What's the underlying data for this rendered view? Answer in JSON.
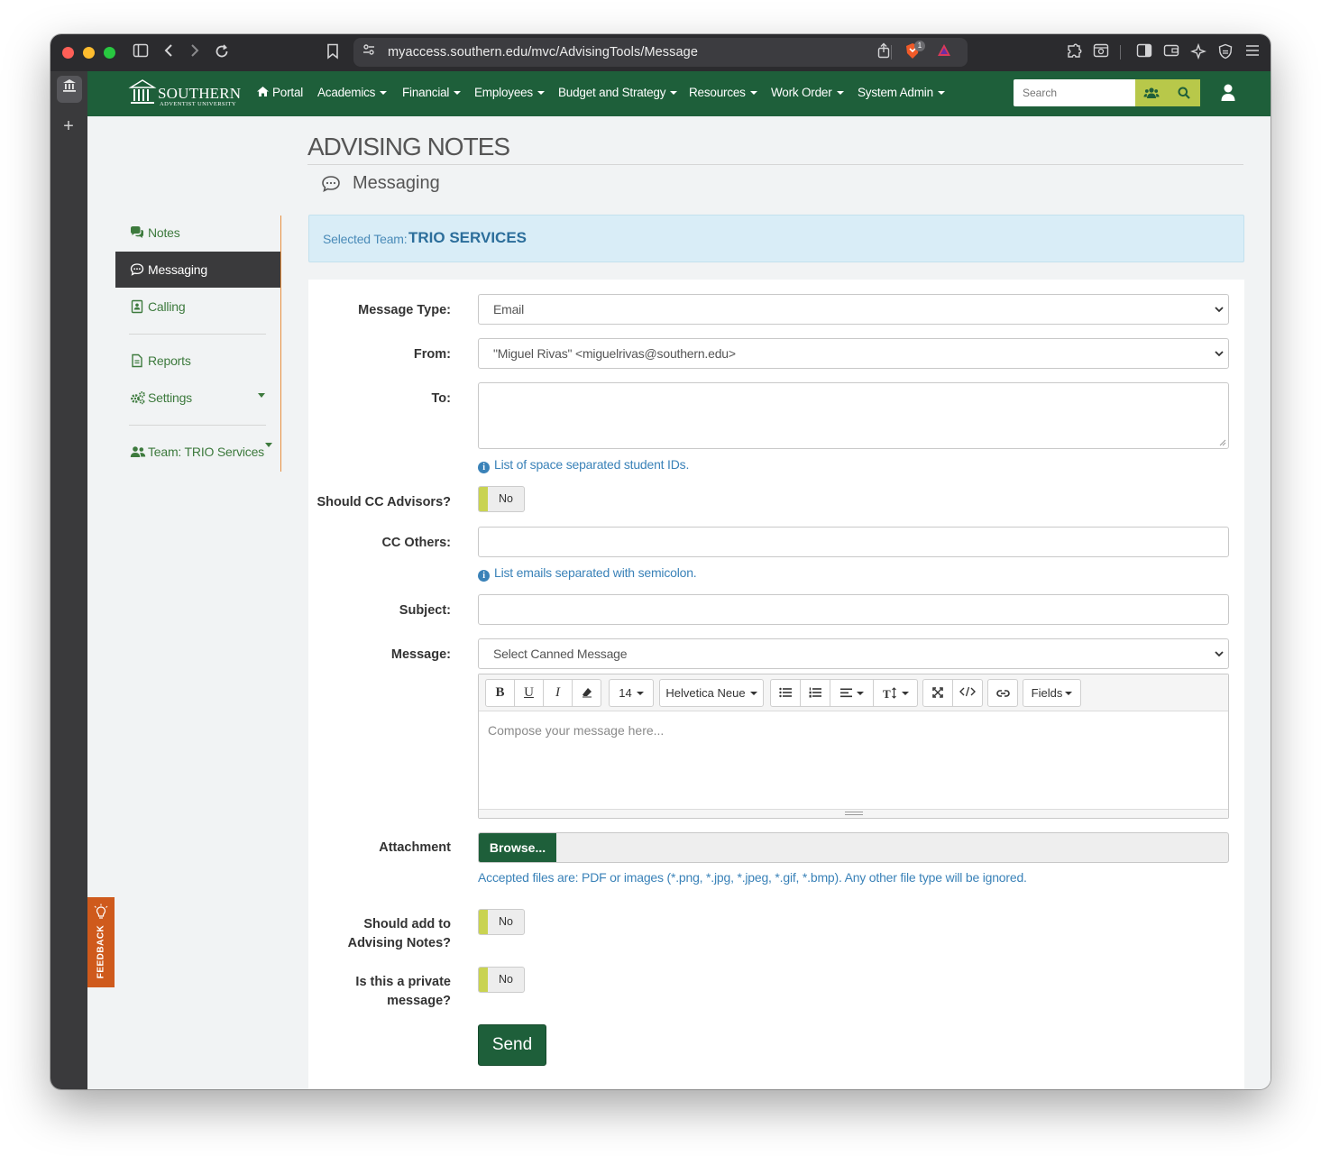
{
  "browser": {
    "url": "myaccess.southern.edu/mvc/AdvisingTools/Message",
    "shield_badge": "1"
  },
  "navbar": {
    "logo_name": "SOUTHERN",
    "logo_sub": "ADVENTIST UNIVERSITY",
    "items": [
      {
        "label": "Portal"
      },
      {
        "label": "Academics"
      },
      {
        "label": "Financial"
      },
      {
        "label": "Employees"
      },
      {
        "label": "Budget and Strategy"
      },
      {
        "label": "Resources"
      },
      {
        "label": "Work Order"
      },
      {
        "label": "System Admin"
      }
    ],
    "search_placeholder": "Search"
  },
  "page": {
    "title": "ADVISING NOTES",
    "subtitle": "Messaging"
  },
  "sidebar": {
    "items": [
      {
        "label": "Notes"
      },
      {
        "label": "Messaging"
      },
      {
        "label": "Calling"
      },
      {
        "label": "Reports"
      },
      {
        "label": "Settings"
      },
      {
        "label": "Team: TRIO Services"
      }
    ]
  },
  "banner": {
    "label": "Selected Team:",
    "team": "TRIO SERVICES"
  },
  "form": {
    "message_type_label": "Message Type:",
    "message_type_value": "Email",
    "from_label": "From:",
    "from_value": "\"Miguel Rivas\" <miguelrivas@southern.edu>",
    "to_label": "To:",
    "to_value": "",
    "to_help": "List of space separated student IDs.",
    "cc_advisors_label": "Should CC Advisors?",
    "cc_advisors_value": "No",
    "cc_others_label": "CC Others:",
    "cc_others_value": "",
    "cc_others_help": "List emails separated with semicolon.",
    "subject_label": "Subject:",
    "subject_value": "",
    "message_label": "Message:",
    "canned_message_value": "Select Canned Message",
    "toolbar": {
      "font_size": "14",
      "font_family": "Helvetica Neue",
      "fields": "Fields"
    },
    "editor_placeholder": "Compose your message here...",
    "attachment_label": "Attachment",
    "browse_label": "Browse...",
    "attachment_help": "Accepted files are: PDF or images (*.png, *.jpg, *.jpeg, *.gif, *.bmp). Any other file type will be ignored.",
    "add_notes_label_1": "Should add to",
    "add_notes_label_2": "Advising Notes?",
    "add_notes_value": "No",
    "private_label_1": "Is this a private",
    "private_label_2": "message?",
    "private_value": "No",
    "send_label": "Send"
  },
  "feedback": {
    "label": "FEEDBACK"
  },
  "colors": {
    "brand_green": "#1e5f3a",
    "accent_yellow": "#c9d351",
    "link_blue": "#3a82b8",
    "sidebar_orange": "#e88f3f",
    "feedback_orange": "#cf5a1c"
  }
}
